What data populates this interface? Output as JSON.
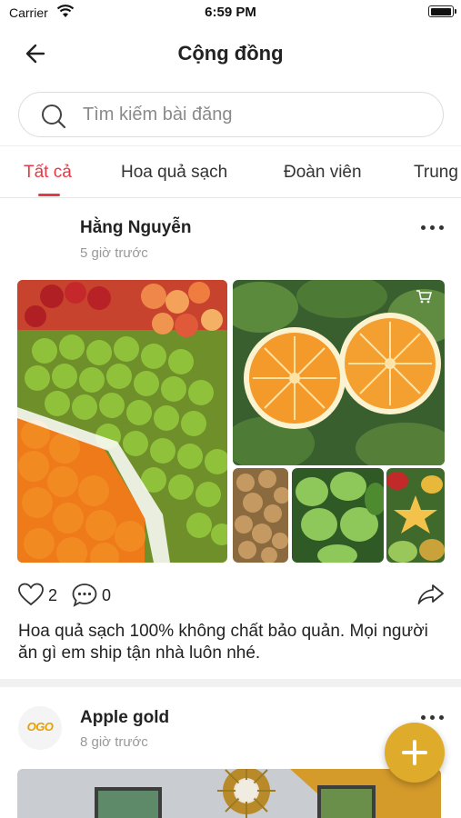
{
  "status_bar": {
    "carrier": "Carrier",
    "time": "6:59 PM"
  },
  "nav": {
    "title": "Cộng đồng",
    "back_icon": "arrow-left-icon"
  },
  "search": {
    "placeholder": "Tìm kiếm bài đăng",
    "value": ""
  },
  "tabs": [
    {
      "label": "Tất cả",
      "active": true
    },
    {
      "label": "Hoa quả sạch",
      "active": false
    },
    {
      "label": "Đoàn viên",
      "active": false
    },
    {
      "label": "Trung",
      "active": false
    }
  ],
  "posts": [
    {
      "author": "Hằng Nguyễn",
      "time": "5 giờ trước",
      "likes": "2",
      "comments": "0",
      "caption": "Hoa quả sạch 100% không chất bảo quản. Mọi người ăn gì em ship tận nhà luôn nhé.",
      "images": [
        "fruit-market-photo",
        "oranges-photo",
        "longan-photo",
        "guava-photo",
        "starfruit-photo"
      ]
    },
    {
      "author": "Apple gold",
      "avatar_text": "OGO",
      "time": "8 giờ trước"
    }
  ],
  "colors": {
    "accent": "#e53945",
    "fab": "#dfab2a",
    "muted": "#999999"
  }
}
